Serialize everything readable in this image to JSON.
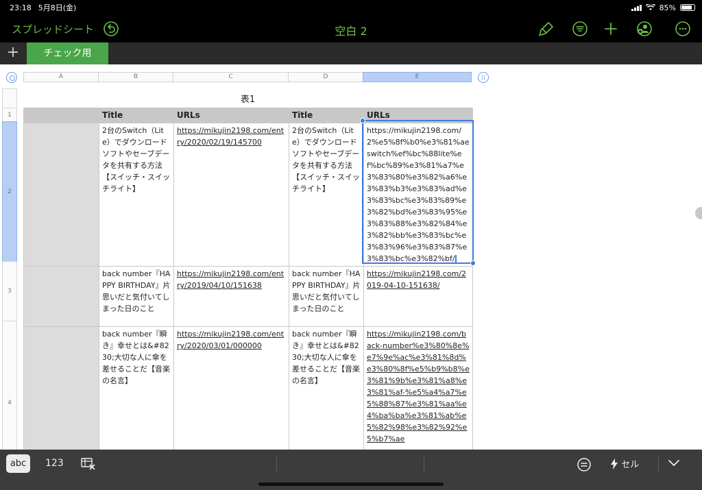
{
  "status": {
    "time": "23:18",
    "date": "5月8日(金)",
    "battery": "85%",
    "battery_level": 0.85
  },
  "toolbar": {
    "back_label": "スプレッドシート",
    "title": "空白 2"
  },
  "sheet_tabs": [
    {
      "label": "チェック用",
      "active": true
    }
  ],
  "columns": [
    "A",
    "B",
    "C",
    "D",
    "E"
  ],
  "selected_column": "E",
  "rows": [
    "1",
    "2",
    "3",
    "4"
  ],
  "selected_row": "2",
  "table": {
    "title": "表1",
    "headers": [
      "Title",
      "URLs",
      "Title",
      "URLs"
    ],
    "rows": [
      {
        "title1": "2台のSwitch（Lite）でダウンロードソフトやセーブデータを共有する方法【スイッチ・スイッチライト】",
        "url1": "https://mikujin2198.com/entry/2020/02/19/145700",
        "title2": "2台のSwitch（Lite）でダウンロードソフトやセーブデータを共有する方法【スイッチ・スイッチライト】",
        "url2": "https://mikujin2198.com/2%e5%8f%b0%e3%81%aeswitch%ef%bc%88lite%ef%bc%89%e3%81%a7%e3%83%80%e3%82%a6%e3%83%b3%e3%83%ad%e3%83%bc%e3%83%89%e3%82%bd%e3%83%95%e3%83%88%e3%82%84%e3%82%bb%e3%83%bc%e3%83%96%e3%83%87%e3%83%bc%e3%82%bf/"
      },
      {
        "title1": "back number『HAPPY BIRTHDAY』片思いだと気付いてしまった日のこと",
        "url1": "https://mikujin2198.com/entry/2019/04/10/151638",
        "title2": "back number『HAPPY BIRTHDAY』片思いだと気付いてしまった日のこと",
        "url2": "https://mikujin2198.com/2019-04-10-151638/"
      },
      {
        "title1": "back number『瞬き』幸せとは&#8230;大切な人に傘を差せることだ【音楽の名言】",
        "url1": "https://mikujin2198.com/entry/2020/03/01/000000",
        "title2": "back number『瞬き』幸せとは&#8230;大切な人に傘を差せることだ【音楽の名言】",
        "url2": "https://mikujin2198.com/back-number%e3%80%8e%e7%9e%ac%e3%81%8d%e3%80%8f%e5%b9%b8%e3%81%9b%e3%81%a8%e3%81%af-%e5%a4%a7%e5%88%87%e3%81%aa%e4%ba%ba%e3%81%ab%e5%82%98%e3%82%92%e5%b7%ae"
      }
    ]
  },
  "keyboard_bar": {
    "abc": "abc",
    "num": "123",
    "cell_label": "セル"
  },
  "colors": {
    "accent": "#6cc04a",
    "tab_active": "#4aa64a",
    "selection": "#3d7be0",
    "header_fill": "#c8c8c8"
  },
  "icons": [
    "undo-icon",
    "paintbrush-icon",
    "list-icon",
    "plus-icon",
    "add-person-icon",
    "more-icon",
    "clear-format-icon",
    "lightning-icon",
    "chevron-down-icon"
  ]
}
